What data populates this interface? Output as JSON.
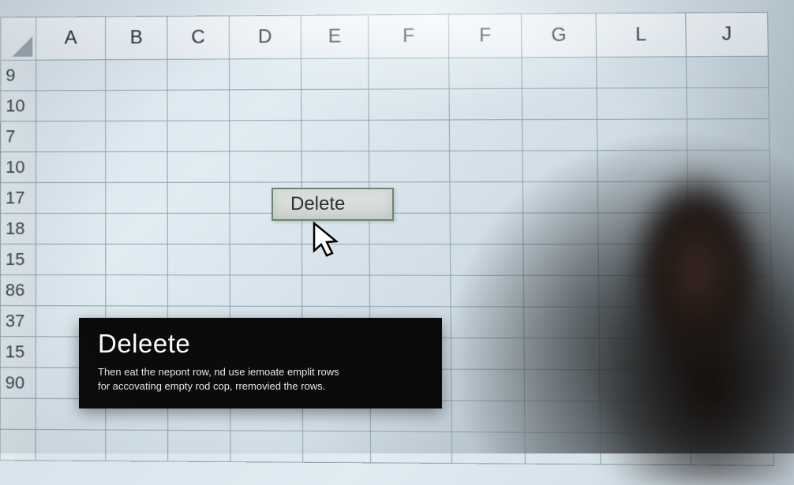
{
  "spreadsheet": {
    "columns": [
      "A",
      "B",
      "C",
      "D",
      "E",
      "F",
      "F",
      "G",
      "L",
      "J"
    ],
    "rows": [
      "9",
      "10",
      "7",
      "10",
      "17",
      "18",
      "15",
      "86",
      "37",
      "15",
      "90"
    ]
  },
  "context_menu": {
    "label": "Delete"
  },
  "tooltip": {
    "title": "Deleete",
    "body1": "Then eat the nepont row, nd use iemoate emplit rows",
    "body2": "for accovating empty rod cop, rremovied the rows."
  }
}
